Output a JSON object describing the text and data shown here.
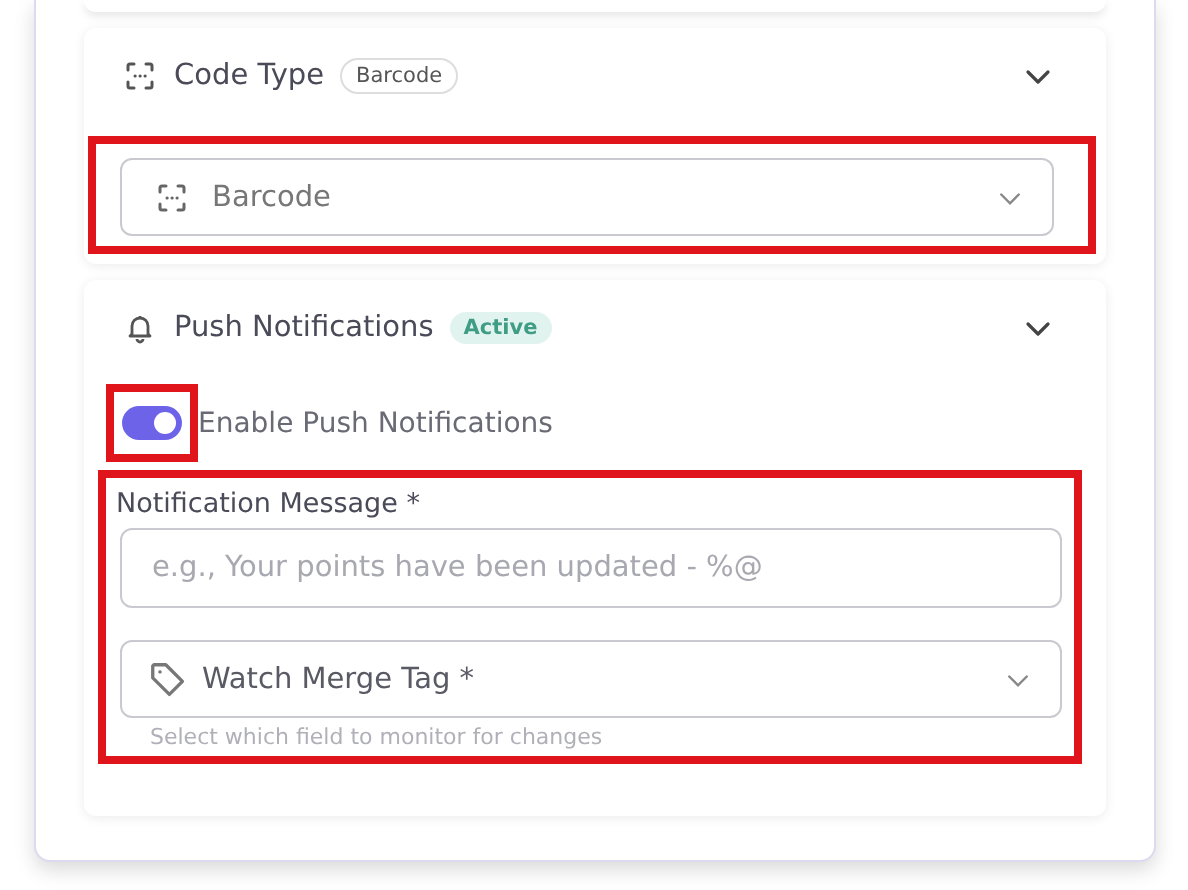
{
  "code_type": {
    "title": "Code Type",
    "badge": "Barcode",
    "expanded": true,
    "select": {
      "value": "Barcode"
    }
  },
  "push_notifications": {
    "title": "Push Notifications",
    "badge": "Active",
    "expanded": true,
    "toggle": {
      "label": "Enable Push Notifications",
      "on": true
    },
    "message": {
      "label": "Notification Message *",
      "placeholder": "e.g., Your points have been updated - %@"
    },
    "merge_tag": {
      "label": "Watch Merge Tag *",
      "hint": "Select which field to monitor for changes"
    }
  }
}
